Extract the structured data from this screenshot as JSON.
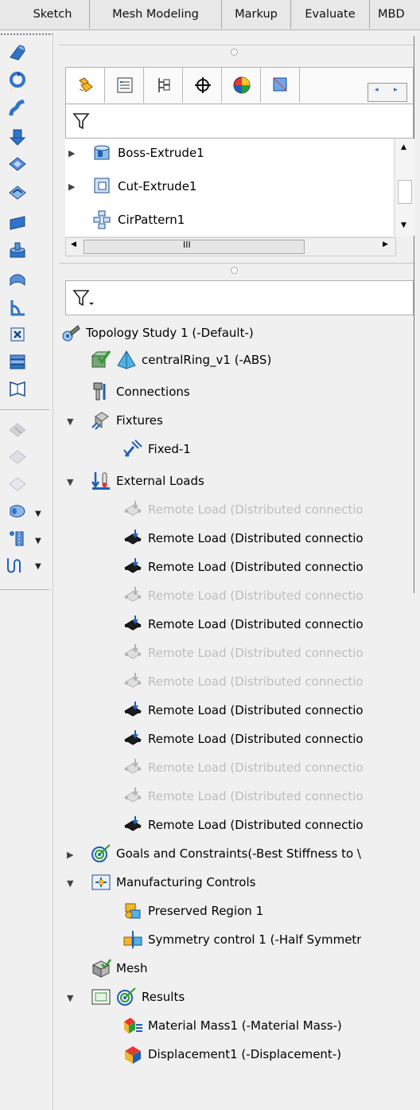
{
  "command_manager": {
    "tabs": [
      "Sketch",
      "Mesh Modeling",
      "Markup",
      "Evaluate",
      "MBD"
    ]
  },
  "toolbar": {
    "icons": [
      "extruded-boss-icon",
      "revolved-boss-icon",
      "swept-boss-icon",
      "extruded-cut-icon",
      "hole-wizard-icon",
      "fillet-icon",
      "reference-plane-icon",
      "shell-icon",
      "draft-icon",
      "rib-icon",
      "wrap-icon",
      "mirror-icon",
      "curve-icon",
      "linear-pattern-icon",
      "sweep-cut-icon",
      "loft-icon",
      "instant3d-icon",
      "helix-icon"
    ]
  },
  "feature_manager": {
    "tabs": [
      "feature-tree-icon",
      "property-manager-icon",
      "configuration-manager-icon",
      "dimxpert-icon",
      "display-manager-icon",
      "simulation-icon"
    ],
    "items": [
      {
        "label": "Boss-Extrude1",
        "icon": "extrude-icon"
      },
      {
        "label": "Cut-Extrude1",
        "icon": "cut-extrude-icon"
      },
      {
        "label": "CirPattern1",
        "icon": "circular-pattern-icon"
      }
    ],
    "scroll_glyph": "III"
  },
  "study_tree": {
    "root": "Topology Study 1 (-Default-)",
    "part": "centralRing_v1 (-ABS)",
    "connections": "Connections",
    "fixtures": "Fixtures",
    "fixed": "Fixed-1",
    "external_loads": "External Loads",
    "remote_loads": [
      {
        "label": "Remote Load (Distributed connectio",
        "suppressed": true
      },
      {
        "label": "Remote Load (Distributed connectio",
        "suppressed": false
      },
      {
        "label": "Remote Load (Distributed connectio",
        "suppressed": false
      },
      {
        "label": "Remote Load (Distributed connectio",
        "suppressed": true
      },
      {
        "label": "Remote Load (Distributed connectio",
        "suppressed": false
      },
      {
        "label": "Remote Load (Distributed connectio",
        "suppressed": true
      },
      {
        "label": "Remote Load (Distributed connectio",
        "suppressed": true
      },
      {
        "label": "Remote Load (Distributed connectio",
        "suppressed": false
      },
      {
        "label": "Remote Load (Distributed connectio",
        "suppressed": false
      },
      {
        "label": "Remote Load (Distributed connectio",
        "suppressed": true
      },
      {
        "label": "Remote Load (Distributed connectio",
        "suppressed": true
      },
      {
        "label": "Remote Load (Distributed connectio",
        "suppressed": false
      }
    ],
    "goals": "Goals and Constraints(-Best Stiffness to \\",
    "manufacturing": "Manufacturing Controls",
    "preserved": "Preserved Region 1",
    "symmetry": "Symmetry control 1 (-Half Symmetr",
    "mesh": "Mesh",
    "results": "Results",
    "material_mass": "Material Mass1 (-Material Mass-)",
    "displacement": "Displacement1 (-Displacement-)"
  },
  "colors": {
    "accent_blue": "#1f5fb8",
    "suppressed_text": "#8c8c8c",
    "green_check": "#2e9b2e"
  }
}
